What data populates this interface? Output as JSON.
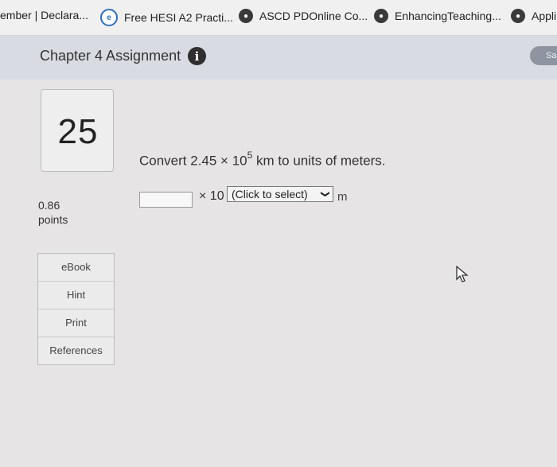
{
  "bookmarks": [
    {
      "label": "ember | Declara...",
      "icon": "none"
    },
    {
      "label": "Free HESI A2 Practi...",
      "icon": "hesi-logo-icon"
    },
    {
      "label": "ASCD PDOnline Co...",
      "icon": "globe-icon"
    },
    {
      "label": "EnhancingTeaching...",
      "icon": "globe-icon"
    },
    {
      "label": "Appli",
      "icon": "globe-icon"
    }
  ],
  "header": {
    "title": "Chapter 4 Assignment",
    "info_icon": "i",
    "save_label": "Sa"
  },
  "question": {
    "number": "25",
    "points_value": "0.86",
    "points_label": "points",
    "prompt_prefix": "Convert 2.45 × 10",
    "prompt_exponent": "5",
    "prompt_suffix": " km to units of meters.",
    "answer_value": "",
    "times_label": "× 10",
    "exponent_select": "(Click to select)",
    "unit": "m"
  },
  "resources": [
    "eBook",
    "Hint",
    "Print",
    "References"
  ],
  "colors": {
    "page_bg": "#e6e4e5",
    "header_bg": "#d9dbe2",
    "save_button": "#8e95a1"
  }
}
